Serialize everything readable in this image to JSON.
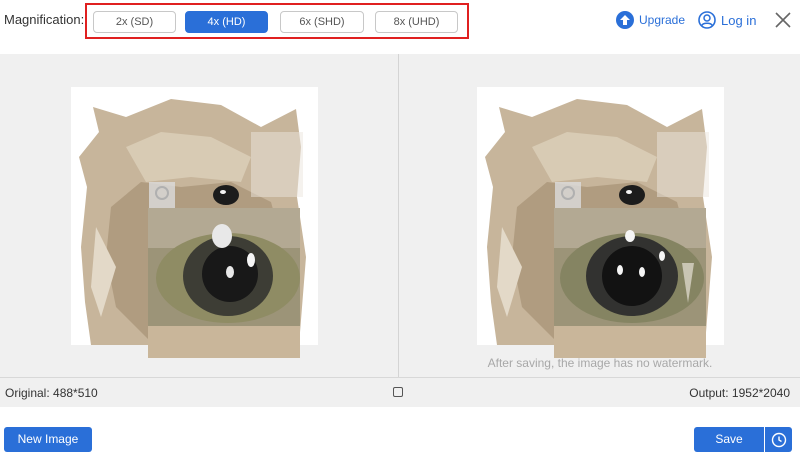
{
  "magnification": {
    "label": "Magnification:",
    "options": [
      {
        "label": "2x (SD)",
        "selected": false
      },
      {
        "label": "4x (HD)",
        "selected": true
      },
      {
        "label": "6x (SHD)",
        "selected": false
      },
      {
        "label": "8x (UHD)",
        "selected": false
      }
    ]
  },
  "header": {
    "upgrade_label": "Upgrade",
    "upgrade_icon": "upgrade-arrow-icon",
    "login_label": "Log in",
    "login_icon": "user-icon",
    "close_icon": "close-icon"
  },
  "preview": {
    "watermark_note": "After saving, the image has no watermark."
  },
  "info": {
    "original": "Original: 488*510",
    "output": "Output: 1952*2040"
  },
  "footer": {
    "new_image_label": "New Image",
    "save_label": "Save",
    "history_icon": "clock-icon"
  },
  "colors": {
    "accent": "#2a6fd8",
    "highlight_box": "#e02020",
    "workspace_bg": "#f0f0f0"
  }
}
